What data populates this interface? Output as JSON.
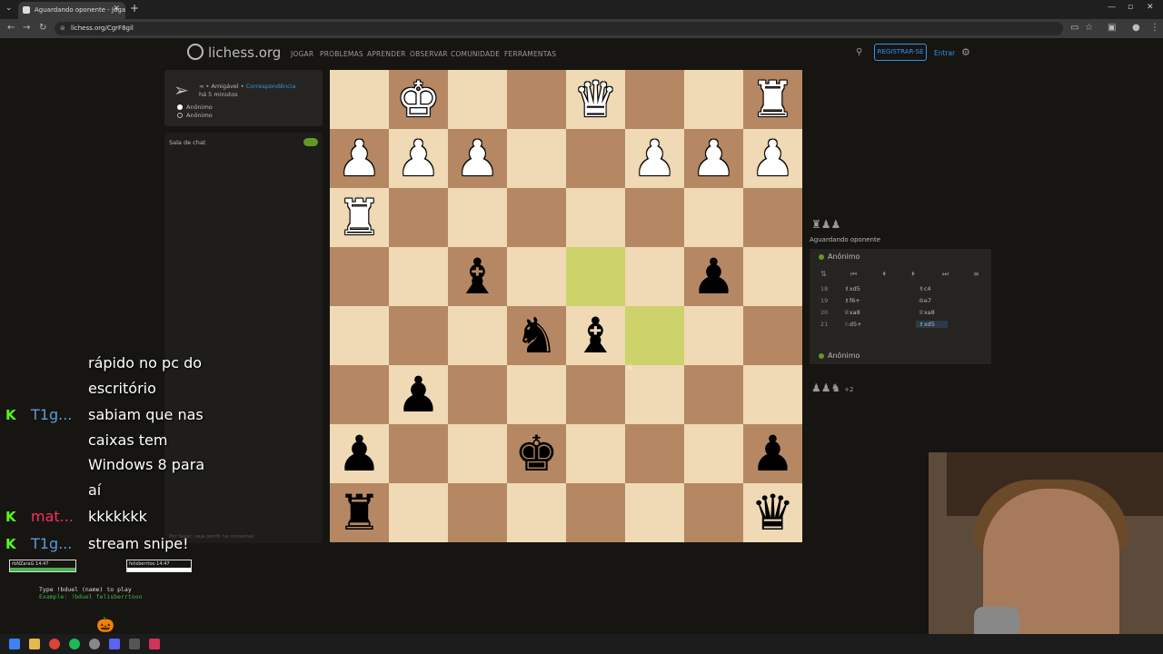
{
  "browser": {
    "tab_title": "Aguardando oponente - Jogar",
    "url": "lichess.org/CgrF8gil"
  },
  "header": {
    "logo": "lichess.org",
    "nav": [
      "JOGAR",
      "PROBLEMAS",
      "APRENDER",
      "OBSERVAR",
      "COMUNIDADE",
      "FERRAMENTAS"
    ],
    "register": "REGISTRAR-SE",
    "login": "Entrar"
  },
  "game_info": {
    "mode": "∞ • Amigável •",
    "variant_link": "Correspondência",
    "time": "há 5 minutos",
    "player_white": "Anônimo",
    "player_black": "Anônimo"
  },
  "chat": {
    "title": "Sala de chat",
    "placeholder": "Por favor, seja gentil na conversa!"
  },
  "board": {
    "orientation": "black",
    "highlight_squares": [
      "c5",
      "d4"
    ],
    "pieces": [
      {
        "square": "g1",
        "piece": "♚",
        "side": "white"
      },
      {
        "square": "d1",
        "piece": "♛",
        "side": "white"
      },
      {
        "square": "a1",
        "piece": "♜",
        "side": "white"
      },
      {
        "square": "h2",
        "piece": "♟",
        "side": "white"
      },
      {
        "square": "g2",
        "piece": "♟",
        "side": "white"
      },
      {
        "square": "f2",
        "piece": "♟",
        "side": "white"
      },
      {
        "square": "c2",
        "piece": "♟",
        "side": "white"
      },
      {
        "square": "b2",
        "piece": "♟",
        "side": "white"
      },
      {
        "square": "a2",
        "piece": "♟",
        "side": "white"
      },
      {
        "square": "h3",
        "piece": "♜",
        "side": "white"
      },
      {
        "square": "f4",
        "piece": "♝",
        "side": "black"
      },
      {
        "square": "b4",
        "piece": "♟",
        "side": "black"
      },
      {
        "square": "e5",
        "piece": "♞",
        "side": "black"
      },
      {
        "square": "d5",
        "piece": "♝",
        "side": "black"
      },
      {
        "square": "g6",
        "piece": "♟",
        "side": "black"
      },
      {
        "square": "h7",
        "piece": "♟",
        "side": "black"
      },
      {
        "square": "e7",
        "piece": "♚",
        "side": "black"
      },
      {
        "square": "a7",
        "piece": "♟",
        "side": "black"
      },
      {
        "square": "h8",
        "piece": "♜",
        "side": "black"
      },
      {
        "square": "a8",
        "piece": "♛",
        "side": "black"
      }
    ]
  },
  "panel": {
    "captured_top": "♜♟♟",
    "status": "Aguardando oponente",
    "player_top": "Anônimo",
    "player_bottom": "Anônimo",
    "captured_bottom": "♟♟♞",
    "captured_bottom_extra": "+2",
    "moves": [
      {
        "n": "18",
        "w": "♗xd5",
        "b": "♗c4"
      },
      {
        "n": "19",
        "w": "♗f6+",
        "b": "♔e7"
      },
      {
        "n": "20",
        "w": "♕xa8",
        "b": "♕xa8"
      },
      {
        "n": "21",
        "w": "♘d5+",
        "b": "♗xd5"
      }
    ]
  },
  "stream_chat": {
    "lines": [
      {
        "user": "",
        "text": "rápido no pc do"
      },
      {
        "user": "",
        "text": "escritório"
      },
      {
        "user": "T1g...",
        "text": "sabiam que nas",
        "color": "#5b9bd5"
      },
      {
        "user": "",
        "text": "caixas tem"
      },
      {
        "user": "",
        "text": "Windows 8 para"
      },
      {
        "user": "",
        "text": "aí"
      },
      {
        "user": "mat...",
        "text": "kkkkkkk",
        "color": "#ff2e5c"
      },
      {
        "user": "T1g...",
        "text": "stream snipe!",
        "color": "#5b9bd5"
      }
    ],
    "duel_left": "rbNZaraG 14:47",
    "duel_right": "felisberrtoo 14:47",
    "duel_instruction": "Type !bduel (name) to play",
    "duel_example": "Example: !bduel felisberrtooo"
  }
}
